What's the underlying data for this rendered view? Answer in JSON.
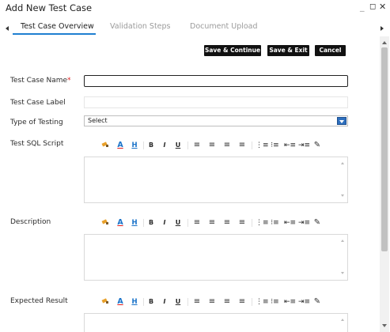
{
  "window": {
    "title": "Add New Test Case",
    "minimize_glyph": "_",
    "maximize_glyph": "◻",
    "close_glyph": "✕"
  },
  "tabs": [
    {
      "label": "Test Case Overview",
      "active": true
    },
    {
      "label": "Validation Steps",
      "active": false
    },
    {
      "label": "Document Upload",
      "active": false
    }
  ],
  "actions": {
    "save_continue": "Save & Continue",
    "save_exit": "Save & Exit",
    "cancel": "Cancel"
  },
  "form": {
    "test_case_name": {
      "label": "Test Case Name",
      "required_mark": "*",
      "value": ""
    },
    "test_case_label": {
      "label": "Test Case Label",
      "value": ""
    },
    "type_of_testing": {
      "label": "Type of Testing",
      "selected": "Select"
    },
    "test_sql_script": {
      "label": "Test SQL Script",
      "value": ""
    },
    "description": {
      "label": "Description",
      "value": ""
    },
    "expected_result": {
      "label": "Expected Result",
      "value": ""
    }
  },
  "toolbar_icons": [
    "highlighter-icon",
    "font-color-icon",
    "highlight-text-icon",
    "bold-icon",
    "italic-icon",
    "underline-icon",
    "align-left-icon",
    "align-center-icon",
    "align-right-icon",
    "justify-icon",
    "ordered-list-icon",
    "unordered-list-icon",
    "outdent-icon",
    "indent-icon",
    "clear-format-icon"
  ],
  "colors": {
    "accent": "#1f7fd1",
    "button_bg": "#111111",
    "required": "#e02020",
    "font_color_icon": "#1a73c9",
    "highlighter_icon": "#e8a02a"
  }
}
